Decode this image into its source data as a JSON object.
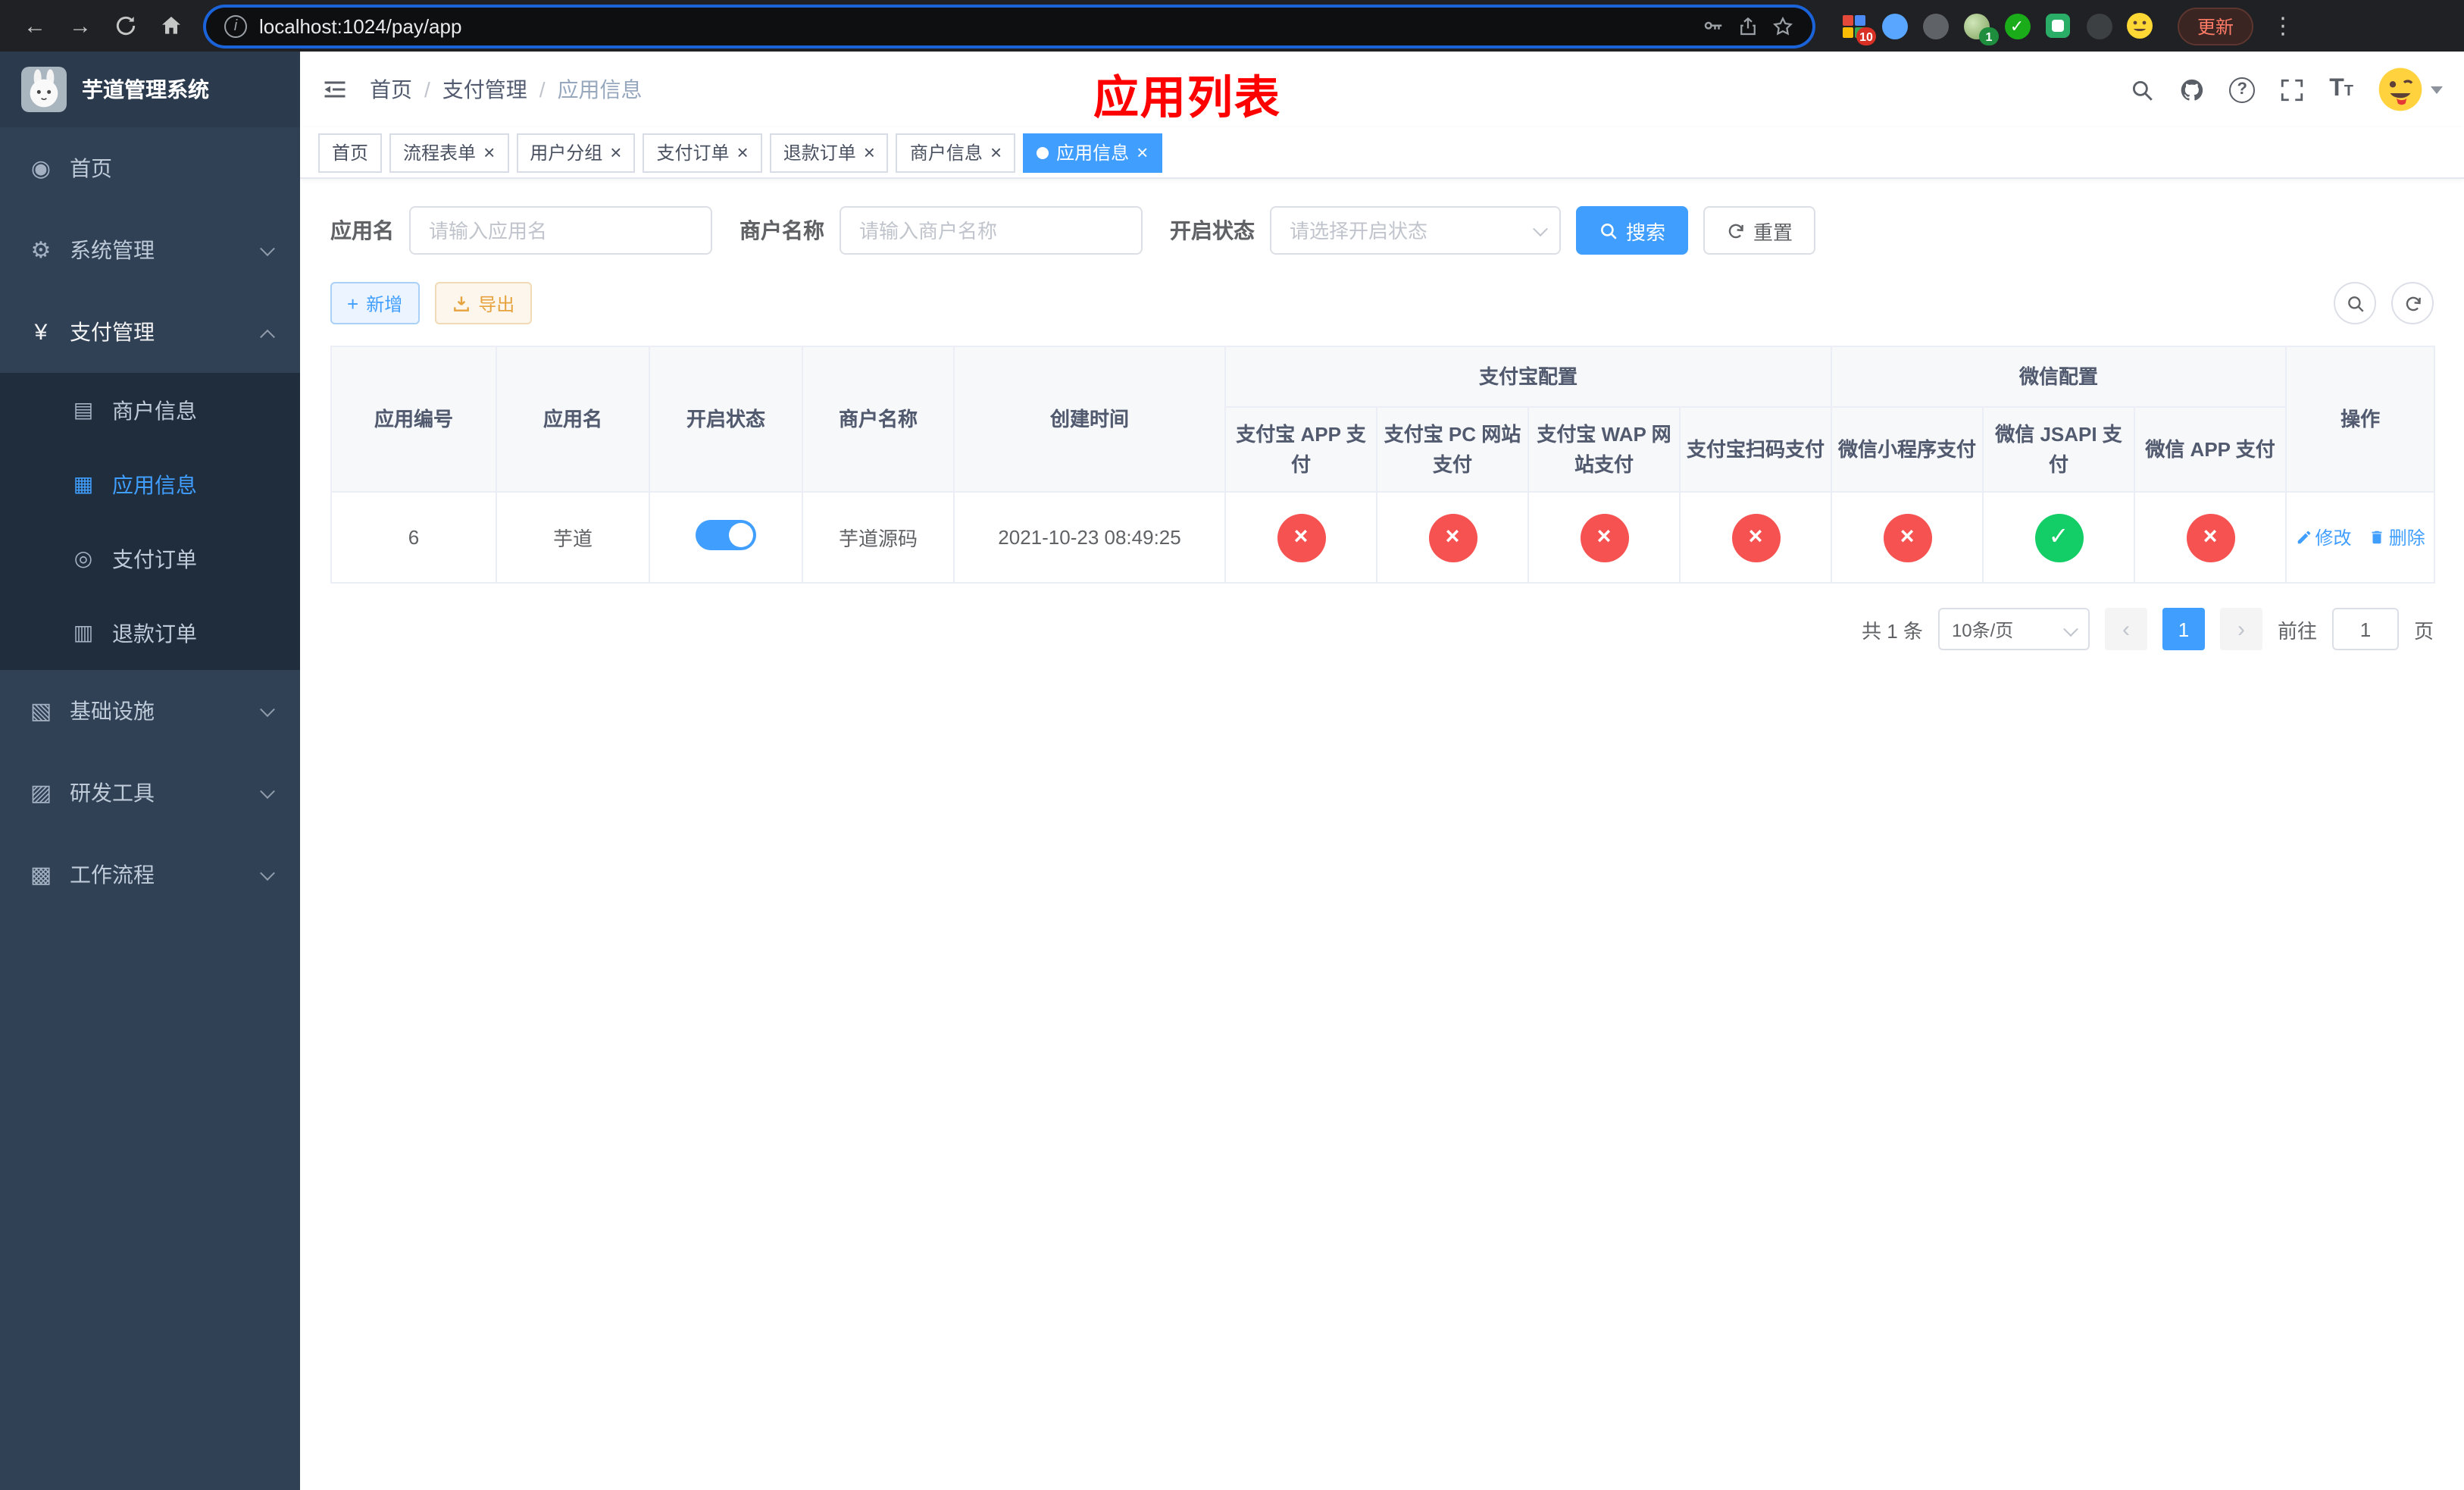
{
  "colors": {
    "accent": "#409eff",
    "success": "#13ce66",
    "danger": "#f65252",
    "warning": "#e6a23c",
    "title_red": "#fe0000",
    "sidebar_bg": "#304156",
    "submenu_bg": "#1f2d3d"
  },
  "browser": {
    "url": "localhost:1024/pay/app",
    "update_label": "更新",
    "ext_badge_grid": "10",
    "ext_badge_avatar": "1"
  },
  "sidebar": {
    "logo_title": "芋道管理系统",
    "menu": [
      {
        "label": "首页"
      },
      {
        "label": "系统管理"
      },
      {
        "label": "支付管理"
      },
      {
        "label": "商户信息"
      },
      {
        "label": "应用信息"
      },
      {
        "label": "支付订单"
      },
      {
        "label": "退款订单"
      },
      {
        "label": "基础设施"
      },
      {
        "label": "研发工具"
      },
      {
        "label": "工作流程"
      }
    ]
  },
  "header": {
    "breadcrumb": [
      "首页",
      "支付管理",
      "应用信息"
    ],
    "page_title": "应用列表"
  },
  "tabs": [
    {
      "label": "首页"
    },
    {
      "label": "流程表单"
    },
    {
      "label": "用户分组"
    },
    {
      "label": "支付订单"
    },
    {
      "label": "退款订单"
    },
    {
      "label": "商户信息"
    },
    {
      "label": "应用信息"
    }
  ],
  "filters": {
    "app_name_label": "应用名",
    "app_name_placeholder": "请输入应用名",
    "merchant_name_label": "商户名称",
    "merchant_name_placeholder": "请输入商户名称",
    "status_label": "开启状态",
    "status_placeholder": "请选择开启状态",
    "search_label": "搜索",
    "reset_label": "重置"
  },
  "toolbar": {
    "add_label": "新增",
    "export_label": "导出"
  },
  "table": {
    "col_app_id": "应用编号",
    "col_app_name": "应用名",
    "col_status": "开启状态",
    "col_merchant": "商户名称",
    "col_created": "创建时间",
    "group_alipay": "支付宝配置",
    "group_wechat": "微信配置",
    "col_alipay_app": "支付宝 APP 支付",
    "col_alipay_pc": "支付宝 PC 网站支付",
    "col_alipay_wap": "支付宝 WAP 网站支付",
    "col_alipay_qr": "支付宝扫码支付",
    "col_wx_mini": "微信小程序支付",
    "col_wx_jsapi": "微信 JSAPI 支付",
    "col_wx_app": "微信 APP 支付",
    "col_actions": "操作",
    "rows": [
      {
        "app_id": "6",
        "app_name": "芋道",
        "enabled": true,
        "merchant": "芋道源码",
        "created": "2021-10-23 08:49:25",
        "statuses": [
          false,
          false,
          false,
          false,
          false,
          true,
          false
        ],
        "edit_label": "修改",
        "delete_label": "删除"
      }
    ]
  },
  "pagination": {
    "total_text": "共 1 条",
    "page_size": "10条/页",
    "current_page": "1",
    "goto_label": "前往",
    "goto_value": "1",
    "page_suffix": "页"
  }
}
